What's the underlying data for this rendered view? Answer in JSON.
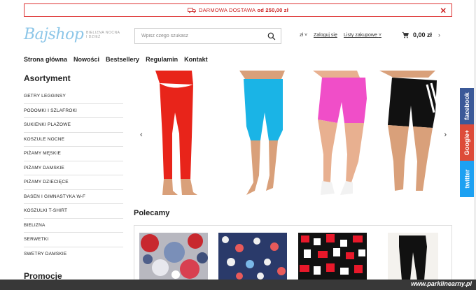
{
  "promo": {
    "text": "DARMOWA DOSTAWA",
    "amount": "od 250,00 zł",
    "close": "✕"
  },
  "brand": {
    "logo": "Bajshop",
    "tagline_1": "BIELIZNA NOCNA",
    "tagline_2": "I DZIEŻ"
  },
  "search": {
    "placeholder": "Wpisz czego szukasz"
  },
  "header": {
    "currency": "zł",
    "login": "Zaloguj się",
    "lists": "Listy zakupowe",
    "cart_total": "0,00 zł"
  },
  "nav": [
    "Strona główna",
    "Nowości",
    "Bestsellery",
    "Regulamin",
    "Kontakt"
  ],
  "sidebar": {
    "title": "Asortyment",
    "items": [
      "GETRY LEGGINSY",
      "PODOMKI I SZLAFROKI",
      "SUKIENKI PLAŻOWE",
      "KOSZULE NOCNE",
      "PIŻAMY MĘSKIE",
      "PIŻAMY DAMSKIE",
      "PIŻAMY DZIECIĘCE",
      "BASEN I GIMNASTYKA W-F",
      "KOSZULKI T-SHIRT",
      "BIELIZNA",
      "SERWETKI",
      "SWETRY DAMSKIE"
    ],
    "promotions_title": "Promocje"
  },
  "slider": {
    "prev": "‹",
    "next": "›",
    "colors": [
      "#e8241a",
      "#1ab4e6",
      "#f04ec8",
      "#111111"
    ]
  },
  "recommended": {
    "title": "Polecamy"
  },
  "social": [
    "facebook",
    "Google+",
    "twitter"
  ],
  "watermark": "www.parklinearny.pl"
}
